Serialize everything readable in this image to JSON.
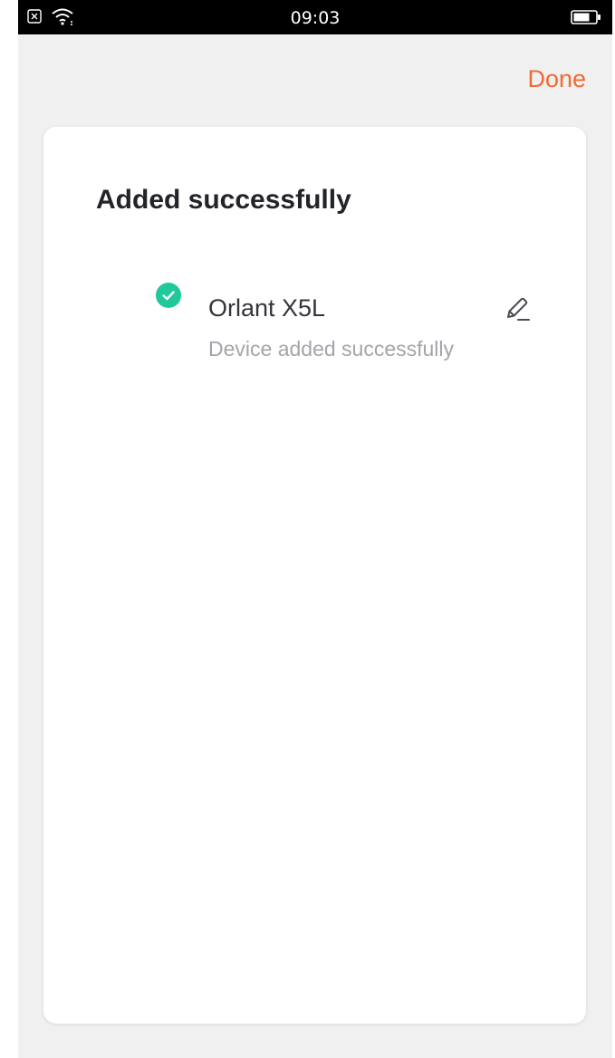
{
  "status_bar": {
    "time": "09:03",
    "icons": [
      "sim-error-icon",
      "wifi-icon",
      "battery-icon"
    ]
  },
  "header": {
    "done_label": "Done"
  },
  "card": {
    "title": "Added successfully",
    "devices": [
      {
        "name": "Orlant X5L",
        "status": "Device added successfully",
        "status_icon": "check-circle-icon",
        "action_icon": "edit-icon"
      }
    ]
  },
  "colors": {
    "accent": "#f26a33",
    "success": "#1fc99a",
    "background": "#f0f0f0",
    "card": "#ffffff",
    "title_text": "#22242a",
    "secondary_text": "#a3a5ab"
  }
}
